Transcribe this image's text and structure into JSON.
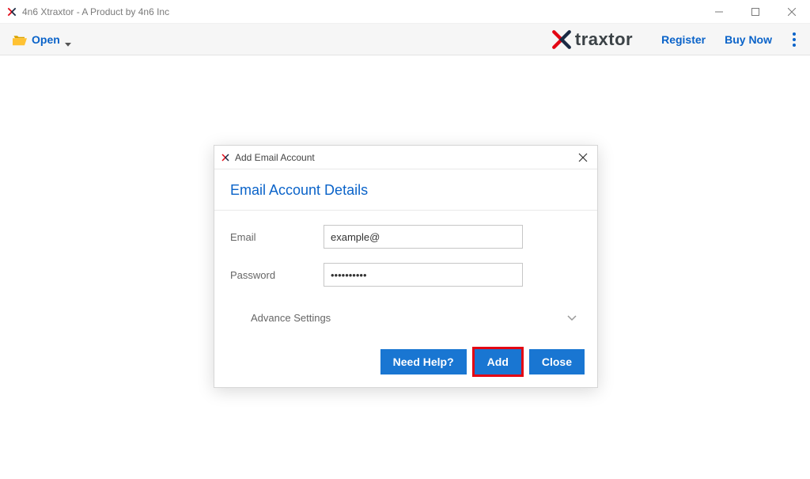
{
  "titlebar": {
    "title": "4n6 Xtraxtor - A Product by 4n6 Inc"
  },
  "toolbar": {
    "open_label": "Open",
    "brand_text": "traxtor",
    "register_label": "Register",
    "buynow_label": "Buy Now"
  },
  "dialog": {
    "title": "Add Email Account",
    "header": "Email Account Details",
    "email_label": "Email",
    "email_value": "example@",
    "password_label": "Password",
    "password_value": "••••••••••",
    "advance_label": "Advance Settings",
    "buttons": {
      "help": "Need Help?",
      "add": "Add",
      "close": "Close"
    }
  }
}
